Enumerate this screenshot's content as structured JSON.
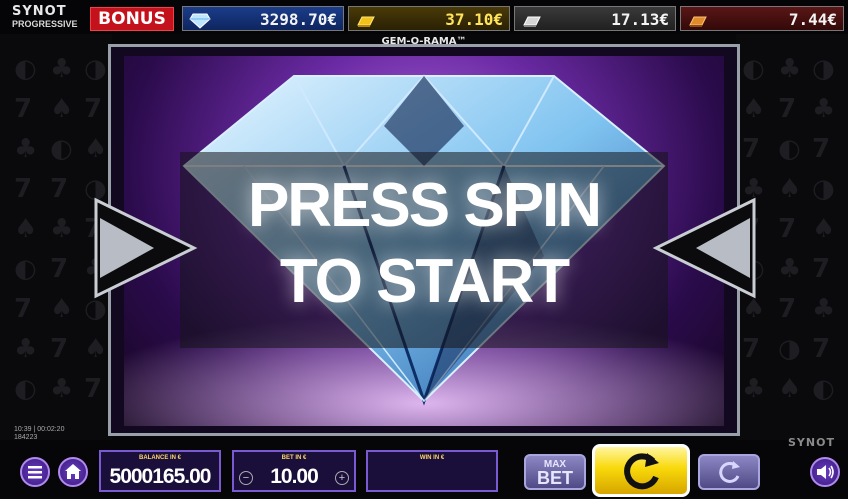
{
  "header": {
    "logo_line1": "SYNOT",
    "logo_line2": "PROGRESSIVE",
    "bonus_label": "BONUS",
    "jackpots": [
      {
        "name": "diamond",
        "icon": "diamond-icon",
        "value": "3298.70€"
      },
      {
        "name": "gold",
        "icon": "gold-bar-icon",
        "value": "37.10€"
      },
      {
        "name": "silver",
        "icon": "silver-bar-icon",
        "value": "17.13€"
      },
      {
        "name": "bronze",
        "icon": "bronze-bar-icon",
        "value": "7.44€"
      }
    ]
  },
  "game": {
    "title": "GEM-O-RAMA™",
    "message_line1": "PRESS SPIN",
    "message_line2": "TO START"
  },
  "status": {
    "time": "10:39 | 00:02:20",
    "id": "184223"
  },
  "controls": {
    "balance_caption": "BALANCE IN €",
    "balance_value": "5000165.00",
    "bet_caption": "BET IN €",
    "bet_value": "10.00",
    "win_caption": "WIN IN €",
    "win_value": "",
    "maxbet_line1": "MAX",
    "maxbet_line2": "BET",
    "brand": "SYNOT"
  },
  "colors": {
    "spin_button": "#f8d90a",
    "accent_purple": "#7a5ad0",
    "bonus_red": "#c4121c"
  }
}
